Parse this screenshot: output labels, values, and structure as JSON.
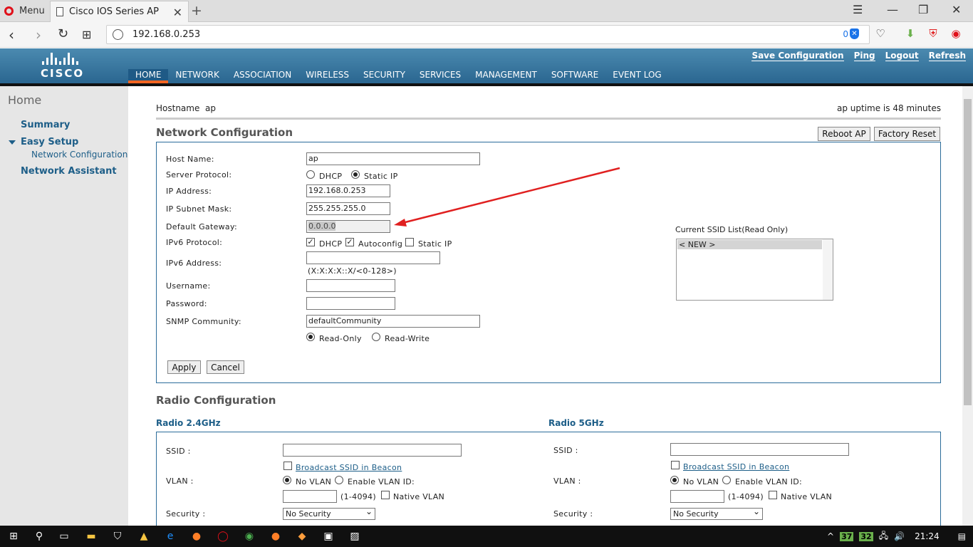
{
  "browser": {
    "menu_label": "Menu",
    "tab_title": "Cisco IOS Series AP",
    "tab_close": "✕",
    "new_tab": "+",
    "url": "192.168.0.253",
    "adblock_count": "0"
  },
  "header": {
    "logo_text": "CISCO",
    "top_links": [
      "Save Configuration",
      "Ping",
      "Logout",
      "Refresh"
    ],
    "nav": [
      "HOME",
      "NETWORK",
      "ASSOCIATION",
      "WIRELESS",
      "SECURITY",
      "SERVICES",
      "MANAGEMENT",
      "SOFTWARE",
      "EVENT LOG"
    ],
    "active_nav": "HOME"
  },
  "sidebar": {
    "title": "Home",
    "items": [
      "Summary",
      "Easy Setup",
      "Network Assistant"
    ],
    "sub_item": "Network Configuration"
  },
  "status": {
    "hostname_label": "Hostname  ap",
    "uptime": "ap uptime is 48 minutes"
  },
  "network_config": {
    "title": "Network Configuration",
    "reboot_button": "Reboot AP",
    "factory_reset_button": "Factory Reset",
    "labels": {
      "host_name": "Host Name:",
      "server_protocol": "Server Protocol:",
      "ip_address": "IP Address:",
      "subnet_mask": "IP Subnet Mask:",
      "default_gateway": "Default Gateway:",
      "ipv6_protocol": "IPv6 Protocol:",
      "ipv6_address": "IPv6 Address:",
      "username": "Username:",
      "password": "Password:",
      "snmp": "SNMP Community:"
    },
    "values": {
      "host_name": "ap",
      "ip_address": "192.168.0.253",
      "subnet_mask": "255.255.255.0",
      "default_gateway": "0.0.0.0",
      "ipv6_address": "",
      "username": "",
      "password": "",
      "snmp": "defaultCommunity"
    },
    "server_protocol_options": [
      "DHCP",
      "Static IP"
    ],
    "server_protocol_selected": "Static IP",
    "ipv6_options": [
      "DHCP",
      "Autoconfig",
      "Static IP"
    ],
    "ipv6_checked": [
      "DHCP",
      "Autoconfig"
    ],
    "ipv6_hint": "(X:X:X:X::X/<0-128>)",
    "snmp_options": [
      "Read-Only",
      "Read-Write"
    ],
    "snmp_selected": "Read-Only",
    "apply_button": "Apply",
    "cancel_button": "Cancel",
    "ssid_list_title": "Current SSID List(Read Only)",
    "ssid_list_items": [
      "< NEW >"
    ]
  },
  "radio_config": {
    "title": "Radio Configuration",
    "radio_24": {
      "heading": "Radio 2.4GHz",
      "ssid_label": "SSID :",
      "ssid_value": "",
      "broadcast_label": "Broadcast SSID in Beacon",
      "vlan_label": "VLAN :",
      "no_vlan": "No VLAN",
      "enable_vlan": "Enable VLAN ID:",
      "vlan_range": "(1-4094)",
      "native_vlan": "Native VLAN",
      "security_label": "Security :",
      "security_value": "No Security"
    },
    "radio_5": {
      "heading": "Radio 5GHz",
      "ssid_label": "SSID :",
      "ssid_value": "",
      "broadcast_label": "Broadcast SSID in Beacon",
      "vlan_label": "VLAN :",
      "no_vlan": "No VLAN",
      "enable_vlan": "Enable VLAN ID:",
      "vlan_range": "(1-4094)",
      "native_vlan": "Native VLAN",
      "security_label": "Security :",
      "security_value": "No Security"
    }
  },
  "taskbar": {
    "tray_badge_1": "37",
    "tray_badge_2": "32",
    "time": "21:24"
  },
  "colors": {
    "header_blue": "#2a6690",
    "link_blue": "#1d5e88",
    "active_underline": "#f26522",
    "annotation_arrow": "#e02020"
  }
}
